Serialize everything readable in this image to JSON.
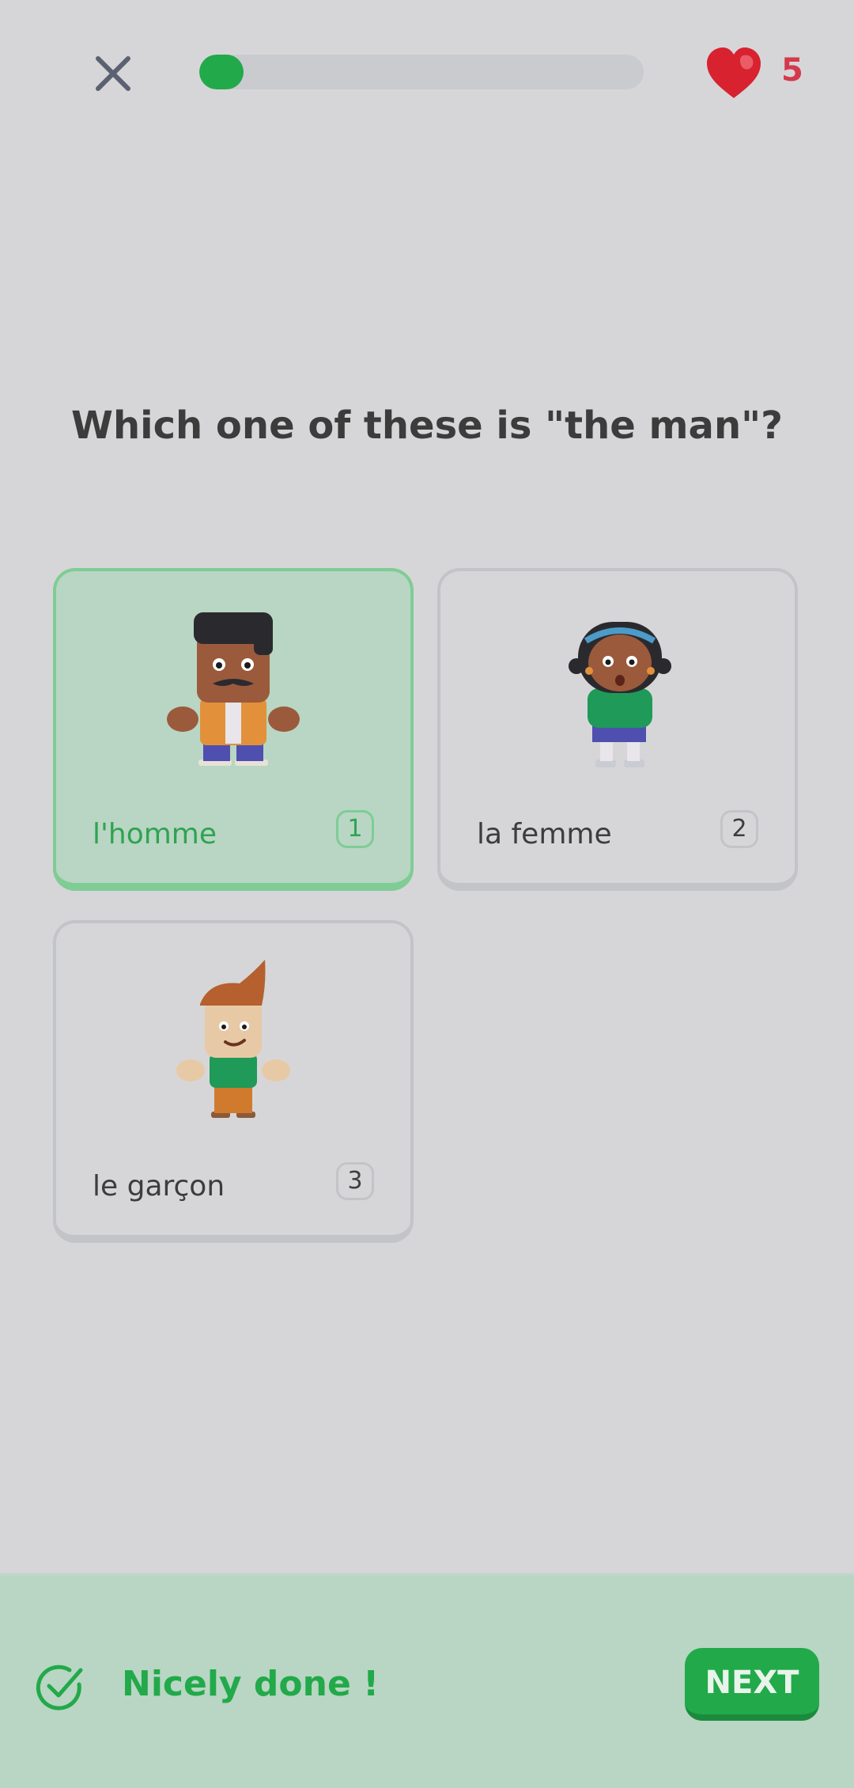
{
  "header": {
    "close_icon": "close-icon",
    "progress": 0.1,
    "hearts_icon": "heart-icon",
    "hearts": "5",
    "progress_color": "#22a94a",
    "heart_color": "#d33a4c"
  },
  "question": "Which one of these is \"the man\"?",
  "options": [
    {
      "label": "l'homme",
      "number": "1",
      "selected": true,
      "icon": "man-character-icon"
    },
    {
      "label": "la femme",
      "number": "2",
      "selected": false,
      "icon": "woman-character-icon"
    },
    {
      "label": "le garçon",
      "number": "3",
      "selected": false,
      "icon": "boy-character-icon"
    }
  ],
  "footer": {
    "icon": "check-circle-icon",
    "message": "Nicely done !",
    "next_label": "NEXT",
    "accent": "#22a94a"
  }
}
